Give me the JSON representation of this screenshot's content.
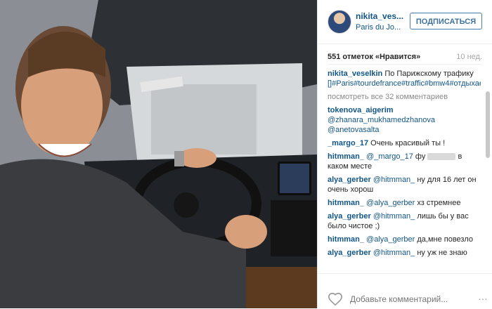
{
  "post": {
    "username": "nikita_ves...",
    "location": "Paris du Jo...",
    "follow_label": "ПОДПИСАТЬСЯ",
    "likes": "551 отметок «Нравится»",
    "time_ago": "10 нед."
  },
  "comments": [
    {
      "user": "nikita_veselkin",
      "text": "По Парижскому трафику",
      "tags": "[]#Paris#tourdefrance#traffic#bmw4#отдыхаемкрасиво"
    },
    {
      "view_all": "посмотреть все 32 комментариев"
    },
    {
      "user": "tokenova_aigerim",
      "mentions": "@zhanara_mukhamedzhanova @anetovasalta"
    },
    {
      "user": "_margo_17",
      "text": "Очень красивый ты !"
    },
    {
      "user": "hitmman_",
      "mention": "@_margo_17",
      "text_before": "фу",
      "text_after": "в каком месте"
    },
    {
      "user": "alya_gerber",
      "mention": "@hitmman_",
      "text": "ну для 16 лет он очень хорош"
    },
    {
      "user": "hitmman_",
      "mention": "@alya_gerber",
      "text": "хз стремнее"
    },
    {
      "user": "alya_gerber",
      "mention": "@hitmman_",
      "text": "лишь бы у вас было чистое ;)"
    },
    {
      "user": "hitmman_",
      "mention": "@alya_gerber",
      "text": "да,мне повезло"
    },
    {
      "user": "alya_gerber",
      "mention": "@hitmman_",
      "text": "ну уж не знаю"
    }
  ],
  "footer": {
    "comment_placeholder": "Добавьте комментарий...",
    "more_glyph": "…"
  }
}
